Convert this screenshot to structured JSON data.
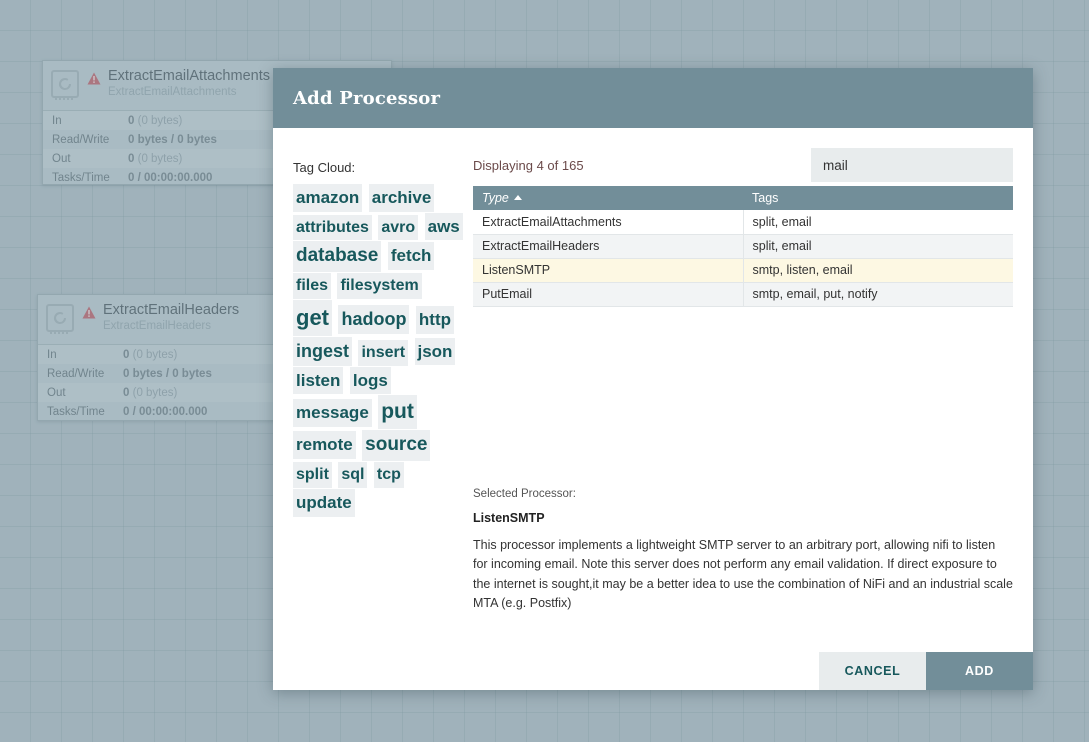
{
  "canvas": {
    "processors": [
      {
        "name": "ExtractEmailAttachments",
        "type": "ExtractEmailAttachments",
        "icon": "processor-chip-icon",
        "status_icon": "warning-triangle-icon",
        "stats": [
          {
            "label": "In",
            "value": "0",
            "detail": "(0 bytes)"
          },
          {
            "label": "Read/Write",
            "value": "0 bytes / 0 bytes",
            "detail": ""
          },
          {
            "label": "Out",
            "value": "0",
            "detail": "(0 bytes)"
          },
          {
            "label": "Tasks/Time",
            "value": "0 / 00:00:00.000",
            "detail": ""
          }
        ]
      },
      {
        "name": "ExtractEmailHeaders",
        "type": "ExtractEmailHeaders",
        "icon": "processor-chip-icon",
        "status_icon": "warning-triangle-icon",
        "stats": [
          {
            "label": "In",
            "value": "0",
            "detail": "(0 bytes)"
          },
          {
            "label": "Read/Write",
            "value": "0 bytes / 0 bytes",
            "detail": ""
          },
          {
            "label": "Out",
            "value": "0",
            "detail": "(0 bytes)"
          },
          {
            "label": "Tasks/Time",
            "value": "0 / 00:00:00.000",
            "detail": ""
          }
        ]
      }
    ]
  },
  "dialog": {
    "title": "Add Processor",
    "tag_cloud_label": "Tag Cloud:",
    "tags": [
      {
        "label": "amazon",
        "size": 17
      },
      {
        "label": "archive",
        "size": 17
      },
      {
        "label": "attributes",
        "size": 16
      },
      {
        "label": "avro",
        "size": 16
      },
      {
        "label": "aws",
        "size": 17
      },
      {
        "label": "database",
        "size": 19
      },
      {
        "label": "fetch",
        "size": 17
      },
      {
        "label": "files",
        "size": 16
      },
      {
        "label": "filesystem",
        "size": 16
      },
      {
        "label": "get",
        "size": 22
      },
      {
        "label": "hadoop",
        "size": 18
      },
      {
        "label": "http",
        "size": 17
      },
      {
        "label": "ingest",
        "size": 18
      },
      {
        "label": "insert",
        "size": 16
      },
      {
        "label": "json",
        "size": 17
      },
      {
        "label": "listen",
        "size": 17
      },
      {
        "label": "logs",
        "size": 17
      },
      {
        "label": "message",
        "size": 17
      },
      {
        "label": "put",
        "size": 21
      },
      {
        "label": "remote",
        "size": 17
      },
      {
        "label": "source",
        "size": 19
      },
      {
        "label": "split",
        "size": 16
      },
      {
        "label": "sql",
        "size": 16
      },
      {
        "label": "tcp",
        "size": 16
      },
      {
        "label": "update",
        "size": 17
      }
    ],
    "displaying_count": "Displaying 4 of 165",
    "search": {
      "value": "mail",
      "placeholder": ""
    },
    "table": {
      "columns": [
        "Type",
        "Tags"
      ],
      "sort_column": "Type",
      "sort_direction": "asc",
      "rows": [
        {
          "type": "ExtractEmailAttachments",
          "tags": "split, email",
          "selected": false
        },
        {
          "type": "ExtractEmailHeaders",
          "tags": "split, email",
          "selected": false
        },
        {
          "type": "ListenSMTP",
          "tags": "smtp, listen, email",
          "selected": true
        },
        {
          "type": "PutEmail",
          "tags": "smtp, email, put, notify",
          "selected": false
        }
      ]
    },
    "selected_processor": {
      "label": "Selected Processor:",
      "name": "ListenSMTP",
      "description": "This processor implements a lightweight SMTP server to an arbitrary port, allowing nifi to listen for incoming email. Note this server does not perform any email validation. If direct exposure to the internet is sought,it may be a better idea to use the combination of NiFi and an industrial scale MTA (e.g. Postfix)"
    },
    "footer": {
      "cancel_label": "CANCEL",
      "add_label": "ADD"
    }
  },
  "colors": {
    "accent": "#728e99",
    "canvas": "#a5b7bf",
    "tag_text": "#17585c",
    "selected_row": "#fdf8e3",
    "warning": "#b5616a"
  }
}
